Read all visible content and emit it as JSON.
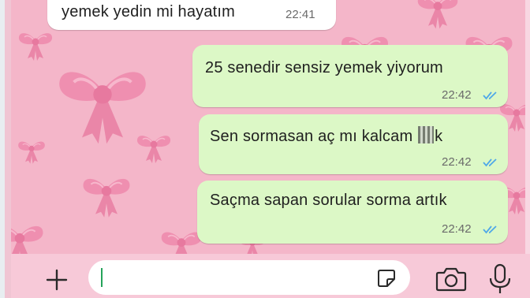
{
  "conversation": {
    "messages": [
      {
        "direction": "incoming",
        "text": "yemek yedin mi hayatım",
        "time": "22:41"
      },
      {
        "direction": "outgoing",
        "text": "25 senedir sensiz yemek yiyorum",
        "time": "22:42",
        "status": "read"
      },
      {
        "direction": "outgoing",
        "text_before": "Sen sormasan aç mı kalcam ",
        "text_after": "k",
        "time": "22:42",
        "status": "read"
      },
      {
        "direction": "outgoing",
        "text": "Saçma sapan sorular sorma artık",
        "time": "22:42",
        "status": "read"
      }
    ]
  },
  "composer": {
    "value": "",
    "icons": [
      "plus-icon",
      "sticker-icon",
      "camera-icon",
      "microphone-icon"
    ]
  },
  "colors": {
    "wallpaper": "#f4b6c9",
    "bow": "#ef8fb0",
    "outgoing_bubble": "#dcf8c6",
    "incoming_bubble": "#ffffff",
    "read_ticks": "#4fa8e8"
  }
}
